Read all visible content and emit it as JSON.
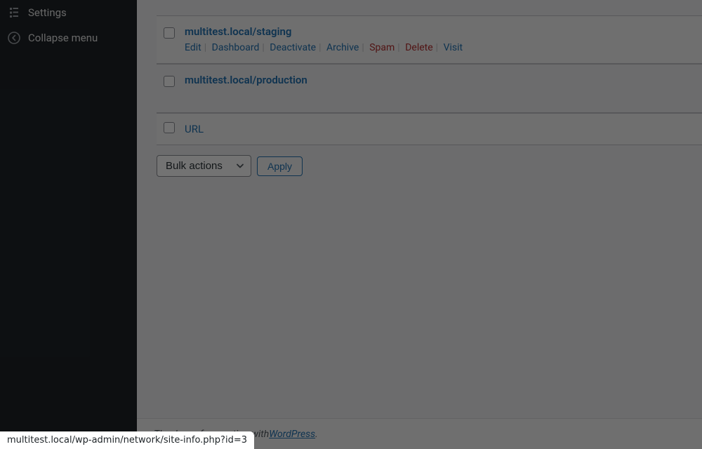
{
  "sidebar": {
    "items": [
      {
        "label": "Settings",
        "icon": "settings-icon"
      },
      {
        "label": "Collapse menu",
        "icon": "collapse-icon"
      }
    ]
  },
  "table": {
    "rows": [
      {
        "title": "multitest.local/staging",
        "actions": {
          "edit": "Edit",
          "dashboard": "Dashboard",
          "deactivate": "Deactivate",
          "archive": "Archive",
          "spam": "Spam",
          "delete": "Delete",
          "visit": "Visit"
        }
      },
      {
        "title": "multitest.local/production"
      }
    ],
    "footer_col": "URL"
  },
  "bulk": {
    "select_label": "Bulk actions",
    "apply": "Apply"
  },
  "footer": {
    "prefix": "Thank you for creating with ",
    "link": "WordPress",
    "suffix": "."
  },
  "status_url": "multitest.local/wp-admin/network/site-info.php?id=3"
}
